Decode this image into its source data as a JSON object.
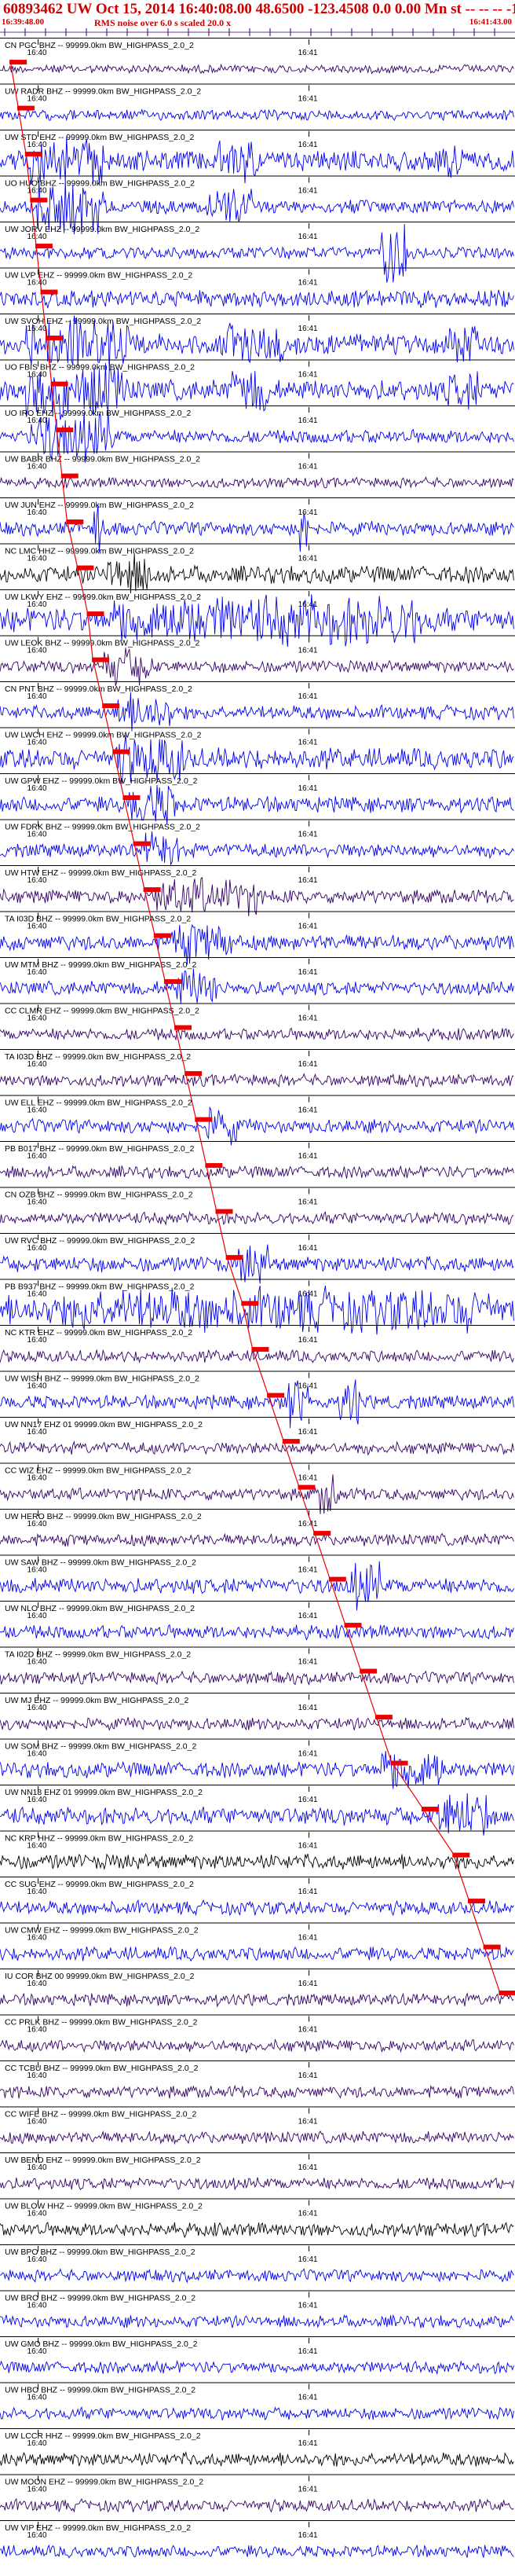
{
  "header": {
    "title": "60893462 UW Oct 15, 2014 16:40:08.00   48.6500 -123.4508  0.0 0.00 Mn st -- -- -- -1",
    "subtitle": "RMS noise over 6.0 s scaled 20.0 x",
    "time_start": "16:39:48.00",
    "time_end": "16:41:43.00"
  },
  "colors": {
    "trace_blue": "#0000ee",
    "trace_purple": "#330066",
    "trace_black": "#000000",
    "pick_red": "#ee0000",
    "label_text": "#000000",
    "tick_text": "#000000"
  },
  "chart_data": {
    "type": "seismogram",
    "title": "60893462 UW Oct 15, 2014 16:40:08.00   48.6500 -123.4508  0.0 0.00 Mn st -- -- -- -1",
    "time_axis": {
      "start_label": "16:39:48.00",
      "end_label": "16:41:43.00",
      "minute_ticks": [
        {
          "label": "16:40",
          "x_frac": 0.074
        },
        {
          "label": "16:41",
          "x_frac": 0.6
        }
      ]
    },
    "traces": [
      {
        "label": "CN PGC BHZ -- 99999.0km BW_HIGHPASS_2.0_2",
        "color": "purple",
        "amp": 0.25,
        "pick_frac": 0.02,
        "bursts": []
      },
      {
        "label": "UW RADR BHZ -- 99999.0km BW_HIGHPASS_2.0_2",
        "color": "blue",
        "amp": 0.3,
        "pick_frac": 0.035,
        "bursts": []
      },
      {
        "label": "UW STD EHZ -- 99999.0km BW_HIGHPASS_2.0_2",
        "color": "blue",
        "amp": 0.6,
        "pick_frac": 0.05,
        "bursts": [
          [
            0.06,
            0.2,
            1.4
          ],
          [
            0.42,
            0.5,
            1.3
          ],
          [
            0.86,
            0.9,
            1.2
          ]
        ]
      },
      {
        "label": "UO HUO BHZ -- 99999.0km BW_HIGHPASS_2.0_2",
        "color": "blue",
        "amp": 0.4,
        "pick_frac": 0.06,
        "bursts": [
          [
            0.07,
            0.2,
            1.6
          ],
          [
            0.4,
            0.49,
            1.3
          ]
        ]
      },
      {
        "label": "UW JORV EHZ -- 99999.0km BW_HIGHPASS_2.0_2",
        "color": "blue",
        "amp": 0.35,
        "pick_frac": 0.07,
        "bursts": [
          [
            0.74,
            0.79,
            2.0
          ]
        ]
      },
      {
        "label": "UW LVP EHZ -- 99999.0km BW_HIGHPASS_2.0_2",
        "color": "blue",
        "amp": 0.5,
        "pick_frac": 0.08,
        "bursts": []
      },
      {
        "label": "UW SVOH EHZ -- 99999.0km BW_HIGHPASS_2.0_2",
        "color": "blue",
        "amp": 0.6,
        "pick_frac": 0.09,
        "bursts": [
          [
            0.05,
            0.25,
            1.6
          ],
          [
            0.44,
            0.55,
            1.4
          ],
          [
            0.87,
            0.93,
            1.3
          ]
        ]
      },
      {
        "label": "UO FBIS BHZ -- 99999.0km BW_HIGHPASS_2.0_2",
        "color": "blue",
        "amp": 0.6,
        "pick_frac": 0.1,
        "bursts": [
          [
            0.05,
            0.25,
            1.6
          ],
          [
            0.45,
            0.52,
            1.4
          ],
          [
            0.87,
            0.93,
            1.2
          ]
        ]
      },
      {
        "label": "UO IRO EHZ -- 99999.0km BW_HIGHPASS_2.0_2",
        "color": "blue",
        "amp": 0.4,
        "pick_frac": 0.11,
        "bursts": [
          [
            0.06,
            0.22,
            1.5
          ]
        ]
      },
      {
        "label": "UW BABR BHZ -- 99999.0km BW_HIGHPASS_2.0_2",
        "color": "purple",
        "amp": 0.3,
        "pick_frac": 0.12,
        "bursts": []
      },
      {
        "label": "UW JUN EHZ -- 99999.0km BW_HIGHPASS_2.0_2",
        "color": "blue",
        "amp": 0.4,
        "pick_frac": 0.13,
        "bursts": [
          [
            0.18,
            0.2,
            1.8
          ],
          [
            0.58,
            0.6,
            1.6
          ]
        ]
      },
      {
        "label": "NC LMC HHZ -- 99999.0km BW_HIGHPASS_2.0_2",
        "color": "black",
        "amp": 0.5,
        "pick_frac": 0.15,
        "bursts": [
          [
            0.2,
            0.3,
            1.2
          ]
        ]
      },
      {
        "label": "UW LKWY EHZ -- 99999.0km BW_HIGHPASS_2.0_2",
        "color": "blue",
        "amp": 0.7,
        "pick_frac": 0.17,
        "bursts": [
          [
            0.22,
            0.82,
            1.5
          ]
        ]
      },
      {
        "label": "UW LEOK BHZ -- 99999.0km BW_HIGHPASS_2.0_2",
        "color": "purple",
        "amp": 0.35,
        "pick_frac": 0.18,
        "bursts": [
          [
            0.2,
            0.3,
            1.1
          ]
        ]
      },
      {
        "label": "CN PNT BHZ -- 99999.0km BW_HIGHPASS_2.0_2",
        "color": "blue",
        "amp": 0.4,
        "pick_frac": 0.2,
        "bursts": [
          [
            0.22,
            0.33,
            1.2
          ]
        ]
      },
      {
        "label": "UW LWCH EHZ -- 99999.0km BW_HIGHPASS_2.0_2",
        "color": "blue",
        "amp": 0.6,
        "pick_frac": 0.22,
        "bursts": [
          [
            0.22,
            0.36,
            1.4
          ]
        ]
      },
      {
        "label": "UW GPW EHZ -- 99999.0km BW_HIGHPASS_2.0_2",
        "color": "blue",
        "amp": 0.45,
        "pick_frac": 0.24,
        "bursts": [
          [
            0.25,
            0.34,
            1.3
          ]
        ]
      },
      {
        "label": "UW FDRK BHZ -- 99999.0km BW_HIGHPASS_2.0_2",
        "color": "blue",
        "amp": 0.4,
        "pick_frac": 0.26,
        "bursts": [
          [
            0.28,
            0.35,
            1.1
          ]
        ]
      },
      {
        "label": "UW HTW EHZ -- 99999.0km BW_HIGHPASS_2.0_2",
        "color": "purple",
        "amp": 0.4,
        "pick_frac": 0.28,
        "bursts": [
          [
            0.3,
            0.5,
            1.1
          ]
        ]
      },
      {
        "label": "TA I03D BHZ -- 99999.0km BW_HIGHPASS_2.0_2",
        "color": "blue",
        "amp": 0.45,
        "pick_frac": 0.3,
        "bursts": [
          [
            0.33,
            0.45,
            1.2
          ]
        ]
      },
      {
        "label": "UW MTM BHZ -- 99999.0km BW_HIGHPASS_2.0_2",
        "color": "blue",
        "amp": 0.4,
        "pick_frac": 0.32,
        "bursts": [
          [
            0.34,
            0.42,
            1.2
          ]
        ]
      },
      {
        "label": "CC CLMR EHZ -- 99999.0km BW_HIGHPASS_2.0_2",
        "color": "purple",
        "amp": 0.35,
        "pick_frac": 0.34,
        "bursts": []
      },
      {
        "label": "TA I03D BHZ -- 99999.0km BW_HIGHPASS_2.0_2",
        "color": "purple",
        "amp": 0.35,
        "pick_frac": 0.36,
        "bursts": []
      },
      {
        "label": "UW ELL EHZ -- 99999.0km BW_HIGHPASS_2.0_2",
        "color": "blue",
        "amp": 0.4,
        "pick_frac": 0.38,
        "bursts": [
          [
            0.4,
            0.46,
            1.1
          ]
        ]
      },
      {
        "label": "PB B017 BHZ -- 99999.0km BW_HIGHPASS_2.0_2",
        "color": "purple",
        "amp": 0.35,
        "pick_frac": 0.4,
        "bursts": []
      },
      {
        "label": "CN OZB BHZ -- 99999.0km BW_HIGHPASS_2.0_2",
        "color": "purple",
        "amp": 0.35,
        "pick_frac": 0.42,
        "bursts": []
      },
      {
        "label": "UW RVC BHZ -- 99999.0km BW_HIGHPASS_2.0_2",
        "color": "blue",
        "amp": 0.45,
        "pick_frac": 0.44,
        "bursts": [
          [
            0.46,
            0.52,
            1.2
          ]
        ]
      },
      {
        "label": "PB B937 BHZ -- 99999.0km BW_HIGHPASS_2.0_2",
        "color": "blue",
        "amp": 0.9,
        "pick_frac": 0.47,
        "bursts": [
          [
            0.14,
            0.95,
            1.3
          ]
        ]
      },
      {
        "label": "NC KTR EHZ -- 99999.0km BW_HIGHPASS_2.0_2",
        "color": "purple",
        "amp": 0.35,
        "pick_frac": 0.49,
        "bursts": []
      },
      {
        "label": "UW WISH BHZ -- 99999.0km BW_HIGHPASS_2.0_2",
        "color": "blue",
        "amp": 0.4,
        "pick_frac": 0.52,
        "bursts": [
          [
            0.56,
            0.6,
            1.6
          ],
          [
            0.66,
            0.7,
            1.6
          ]
        ]
      },
      {
        "label": "UW NN17 EHZ 01 99999.0km BW_HIGHPASS_2.0_2",
        "color": "purple",
        "amp": 0.35,
        "pick_frac": 0.55,
        "bursts": []
      },
      {
        "label": "CC WIZ EHZ -- 99999.0km BW_HIGHPASS_2.0_2",
        "color": "purple",
        "amp": 0.35,
        "pick_frac": 0.58,
        "bursts": [
          [
            0.62,
            0.66,
            1.2
          ]
        ]
      },
      {
        "label": "UW HERO BHZ -- 99999.0km BW_HIGHPASS_2.0_2",
        "color": "purple",
        "amp": 0.35,
        "pick_frac": 0.61,
        "bursts": []
      },
      {
        "label": "UW SAW BHZ -- 99999.0km BW_HIGHPASS_2.0_2",
        "color": "blue",
        "amp": 0.45,
        "pick_frac": 0.64,
        "bursts": [
          [
            0.68,
            0.74,
            1.4
          ]
        ]
      },
      {
        "label": "UW NLO BHZ -- 99999.0km BW_HIGHPASS_2.0_2",
        "color": "blue",
        "amp": 0.4,
        "pick_frac": 0.67,
        "bursts": []
      },
      {
        "label": "TA I02D BHZ -- 99999.0km BW_HIGHPASS_2.0_2",
        "color": "purple",
        "amp": 0.35,
        "pick_frac": 0.7,
        "bursts": []
      },
      {
        "label": "UW MJ EHZ -- 99999.0km BW_HIGHPASS_2.0_2",
        "color": "purple",
        "amp": 0.35,
        "pick_frac": 0.73,
        "bursts": []
      },
      {
        "label": "UW SOM BHZ -- 99999.0km BW_HIGHPASS_2.0_2",
        "color": "blue",
        "amp": 0.45,
        "pick_frac": 0.76,
        "bursts": [
          [
            0.74,
            0.86,
            1.4
          ]
        ]
      },
      {
        "label": "UW NN18 EHZ 01 99999.0km BW_HIGHPASS_2.0_2",
        "color": "blue",
        "amp": 0.5,
        "pick_frac": 0.82,
        "bursts": [
          [
            0.85,
            0.95,
            1.5
          ]
        ]
      },
      {
        "label": "NC KRP HHZ -- 99999.0km BW_HIGHPASS_2.0_2",
        "color": "black",
        "amp": 0.45,
        "pick_frac": 0.88,
        "bursts": []
      },
      {
        "label": "CC SUG EHZ -- 99999.0km BW_HIGHPASS_2.0_2",
        "color": "blue",
        "amp": 0.4,
        "pick_frac": 0.91,
        "bursts": []
      },
      {
        "label": "UW CMW EHZ -- 99999.0km BW_HIGHPASS_2.0_2",
        "color": "blue",
        "amp": 0.4,
        "pick_frac": 0.94,
        "bursts": []
      },
      {
        "label": "IU COR BHZ 00 99999.0km BW_HIGHPASS_2.0_2",
        "color": "purple",
        "amp": 0.35,
        "pick_frac": 0.97,
        "bursts": []
      },
      {
        "label": "CC PRLK BHZ -- 99999.0km BW_HIGHPASS_2.0_2",
        "color": "purple",
        "amp": 0.35,
        "pick_frac": null,
        "bursts": []
      },
      {
        "label": "CC TCBU BHZ -- 99999.0km BW_HIGHPASS_2.0_2",
        "color": "purple",
        "amp": 0.35,
        "pick_frac": null,
        "bursts": []
      },
      {
        "label": "CC WIFE BHZ -- 99999.0km BW_HIGHPASS_2.0_2",
        "color": "purple",
        "amp": 0.35,
        "pick_frac": null,
        "bursts": []
      },
      {
        "label": "UW BEND EHZ -- 99999.0km BW_HIGHPASS_2.0_2",
        "color": "purple",
        "amp": 0.35,
        "pick_frac": null,
        "bursts": []
      },
      {
        "label": "UW BLOW HHZ -- 99999.0km BW_HIGHPASS_2.0_2",
        "color": "black",
        "amp": 0.4,
        "pick_frac": null,
        "bursts": []
      },
      {
        "label": "UW BPO BHZ -- 99999.0km BW_HIGHPASS_2.0_2",
        "color": "blue",
        "amp": 0.35,
        "pick_frac": null,
        "bursts": []
      },
      {
        "label": "UW BRO BHZ -- 99999.0km BW_HIGHPASS_2.0_2",
        "color": "blue",
        "amp": 0.35,
        "pick_frac": null,
        "bursts": []
      },
      {
        "label": "UW GMO BHZ -- 99999.0km BW_HIGHPASS_2.0_2",
        "color": "blue",
        "amp": 0.35,
        "pick_frac": null,
        "bursts": []
      },
      {
        "label": "UW HBO BHZ -- 99999.0km BW_HIGHPASS_2.0_2",
        "color": "blue",
        "amp": 0.35,
        "pick_frac": null,
        "bursts": []
      },
      {
        "label": "UW LCCR HHZ -- 99999.0km BW_HIGHPASS_2.0_2",
        "color": "black",
        "amp": 0.4,
        "pick_frac": null,
        "bursts": []
      },
      {
        "label": "UW MOON EHZ -- 99999.0km BW_HIGHPASS_2.0_2",
        "color": "purple",
        "amp": 0.35,
        "pick_frac": null,
        "bursts": []
      },
      {
        "label": "UW VIP EHZ -- 99999.0km BW_HIGHPASS_2.0_2",
        "color": "blue",
        "amp": 0.35,
        "pick_frac": null,
        "bursts": []
      }
    ]
  }
}
